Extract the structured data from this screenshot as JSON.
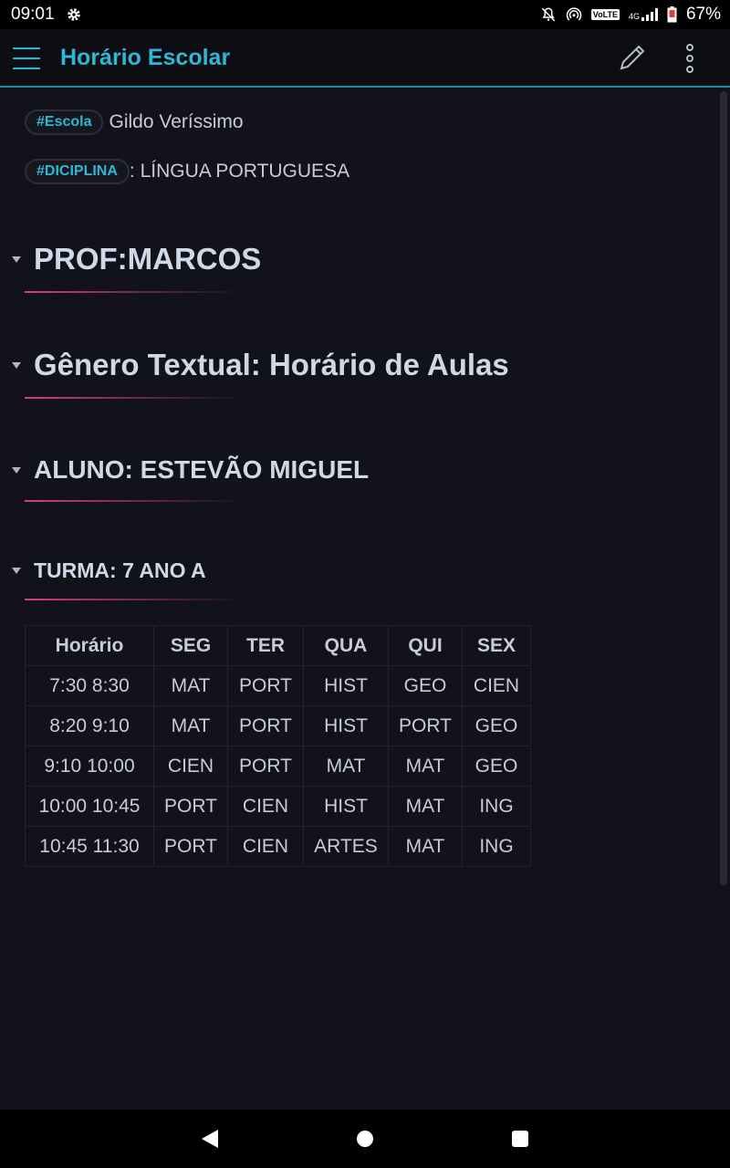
{
  "status_bar": {
    "time": "09:01",
    "network_label": "VoLTE",
    "network_type": "4G",
    "battery": "67%"
  },
  "app_bar": {
    "title": "Horário Escolar"
  },
  "tags": [
    {
      "tag": "#Escola",
      "value": "Gildo Veríssimo"
    },
    {
      "tag": "#DICIPLINA",
      "value": ": LÍNGUA PORTUGUESA"
    }
  ],
  "headings": [
    {
      "text": "PROF:MARCOS"
    },
    {
      "text": "Gênero Textual: Horário de Aulas"
    },
    {
      "text": "ALUNO: ESTEVÃO MIGUEL"
    },
    {
      "text": "TURMA: 7 ANO A"
    }
  ],
  "table": {
    "headers": [
      "Horário",
      "SEG",
      "TER",
      "QUA",
      "QUI",
      "SEX"
    ],
    "rows": [
      [
        "7:30 8:30",
        "MAT",
        "PORT",
        "HIST",
        "GEO",
        "CIEN"
      ],
      [
        "8:20 9:10",
        "MAT",
        "PORT",
        "HIST",
        "PORT",
        "GEO"
      ],
      [
        "9:10 10:00",
        "CIEN",
        "PORT",
        "MAT",
        "MAT",
        "GEO"
      ],
      [
        "10:00 10:45",
        "PORT",
        "CIEN",
        "HIST",
        "MAT",
        "ING"
      ],
      [
        "10:45 11:30",
        "PORT",
        "CIEN",
        "ARTES",
        "MAT",
        "ING"
      ]
    ]
  },
  "colors": {
    "accent": "#2fb8d3",
    "heading_underline": "#d6407e",
    "background": "#12121b"
  },
  "icons": {
    "menu": "hamburger-menu-icon",
    "edit": "pencil-icon",
    "more": "more-vertical-icon",
    "settings": "gear-icon",
    "bell_off": "bell-off-icon",
    "hotspot": "hotspot-icon",
    "signal": "signal-icon",
    "battery": "battery-icon"
  }
}
